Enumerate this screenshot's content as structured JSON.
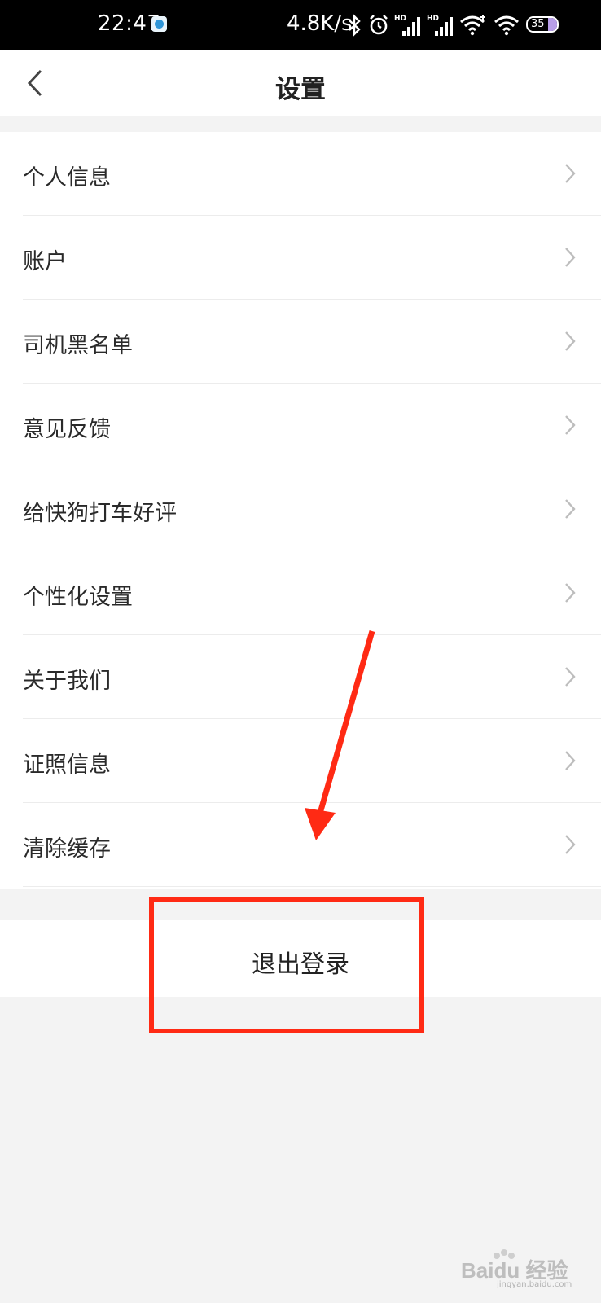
{
  "status_bar": {
    "time": "22:47",
    "net_speed": "4.8K/s",
    "battery": "35",
    "icons": [
      "app-icon",
      "bluetooth-icon",
      "alarm-icon",
      "hd-signal-icon",
      "hd-signal-icon",
      "wifi-icon",
      "wifi-icon",
      "battery-icon"
    ]
  },
  "header": {
    "title": "设置"
  },
  "menu": {
    "items": [
      {
        "label": "个人信息"
      },
      {
        "label": "账户"
      },
      {
        "label": "司机黑名单"
      },
      {
        "label": "意见反馈"
      },
      {
        "label": "给快狗打车好评"
      },
      {
        "label": "个性化设置"
      },
      {
        "label": "关于我们"
      },
      {
        "label": "证照信息"
      },
      {
        "label": "清除缓存"
      }
    ]
  },
  "logout": {
    "label": "退出登录"
  },
  "colors": {
    "annotation": "#ff2a14",
    "background": "#f3f3f3"
  },
  "watermark": {
    "text": "Baidu 经验",
    "sub": "jingyan.baidu.com"
  }
}
